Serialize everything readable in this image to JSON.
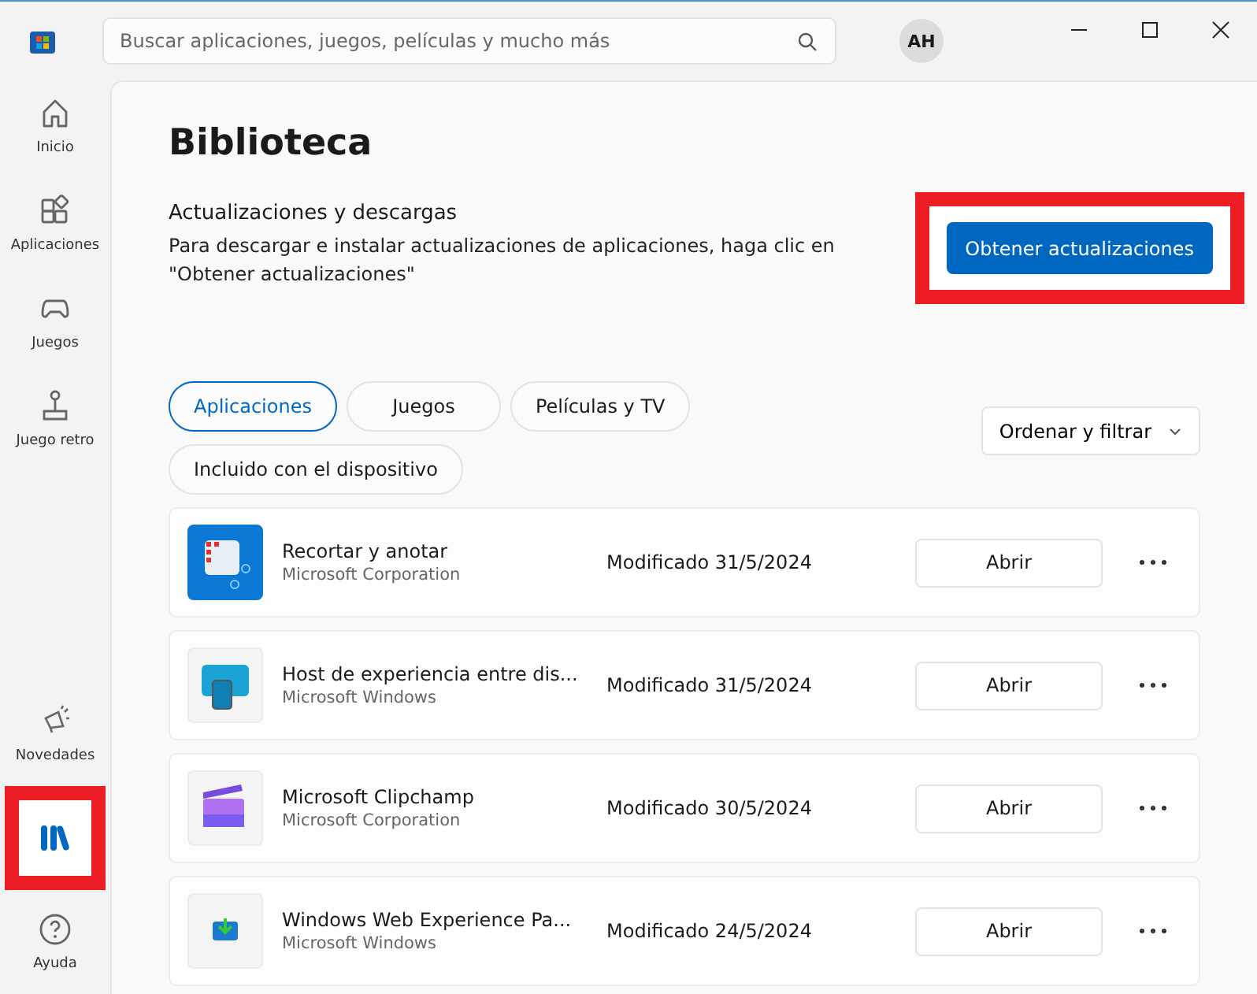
{
  "search": {
    "placeholder": "Buscar aplicaciones, juegos, películas y mucho más"
  },
  "account": {
    "initials": "AH"
  },
  "sidebar": {
    "items": [
      {
        "kind": "home",
        "label": "Inicio",
        "selected": false,
        "highlighted": false
      },
      {
        "kind": "apps",
        "label": "Aplicaciones",
        "selected": false,
        "highlighted": false
      },
      {
        "kind": "gamepad",
        "label": "Juegos",
        "selected": false,
        "highlighted": false
      },
      {
        "kind": "joystick",
        "label": "Juego retro",
        "selected": false,
        "highlighted": false
      }
    ],
    "bottom_items": [
      {
        "kind": "megaphone",
        "label": "Novedades",
        "selected": false,
        "highlighted": false
      },
      {
        "kind": "library",
        "selected": true,
        "highlighted": true
      },
      {
        "kind": "help",
        "label": "Ayuda",
        "selected": false,
        "highlighted": false
      }
    ]
  },
  "page": {
    "title": "Biblioteca",
    "section_title": "Actualizaciones y descargas",
    "description": "Para descargar e instalar actualizaciones de aplicaciones, haga clic en \"Obtener actualizaciones\"",
    "update_button": {
      "label": "Obtener actualizaciones",
      "highlighted": true
    },
    "filters": [
      {
        "label": "Aplicaciones",
        "selected": true
      },
      {
        "label": "Juegos",
        "selected": false
      },
      {
        "label": "Películas y TV",
        "selected": false
      },
      {
        "label": "Incluido con el dispositivo",
        "selected": false
      }
    ],
    "sort_button": "Ordenar y filtrar",
    "apps": [
      {
        "kind": "snip",
        "name": "Recortar y anotar",
        "publisher": "Microsoft Corporation",
        "modified": "Modificado 31/5/2024",
        "action": "Abrir"
      },
      {
        "kind": "host",
        "name": "Host de experiencia entre dis...",
        "publisher": "Microsoft Windows",
        "modified": "Modificado 31/5/2024",
        "action": "Abrir"
      },
      {
        "kind": "clipchamp",
        "name": "Microsoft Clipchamp",
        "publisher": "Microsoft Corporation",
        "modified": "Modificado 30/5/2024",
        "action": "Abrir"
      },
      {
        "kind": "webexp",
        "name": "Windows Web Experience Pa...",
        "publisher": "Microsoft Windows",
        "modified": "Modificado 24/5/2024",
        "action": "Abrir"
      }
    ]
  }
}
